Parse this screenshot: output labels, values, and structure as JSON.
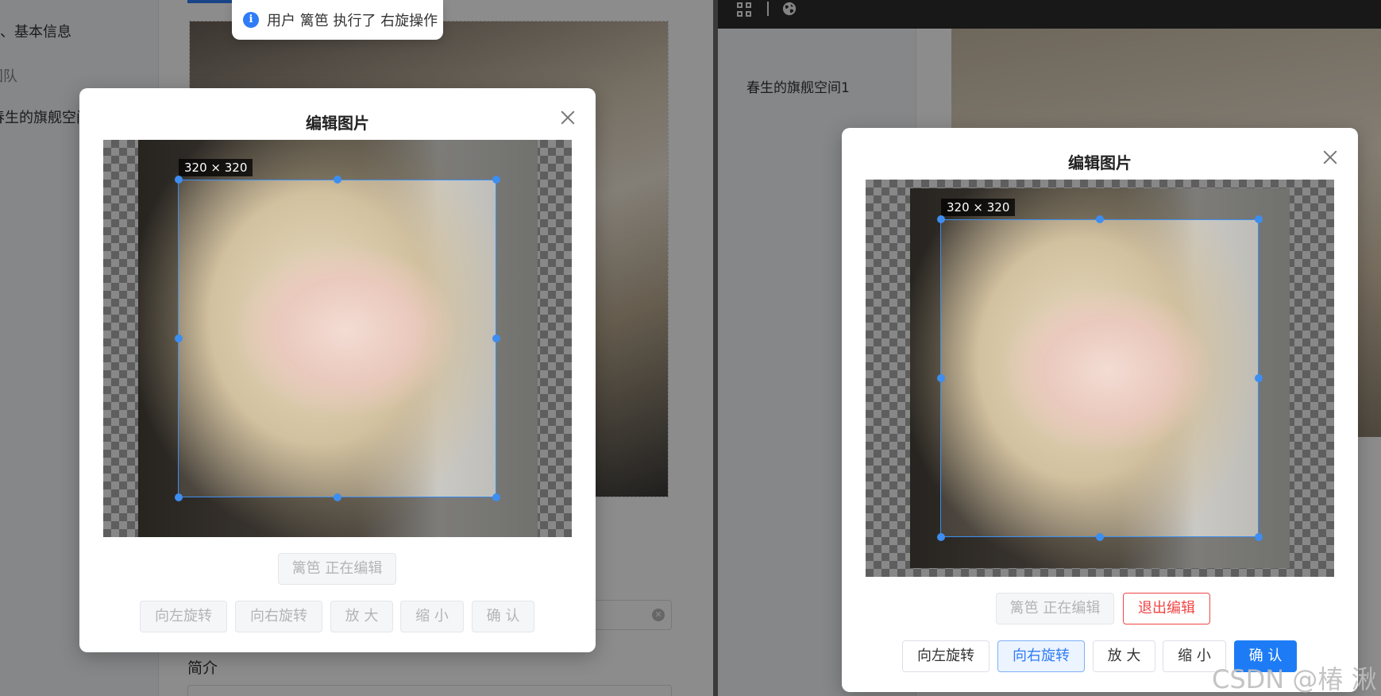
{
  "left": {
    "sidebar": {
      "items": [
        {
          "label": "、基本信息"
        },
        {
          "label": "团队"
        },
        {
          "label": "春生的旗舰空间"
        }
      ]
    },
    "intro_label": "简介",
    "toast": {
      "icon": "info-icon",
      "text": "用户 篱笆 执行了 右旋操作"
    },
    "modal": {
      "title": "编辑图片",
      "crop_size": "320 × 320",
      "editing_status": "篱笆 正在编辑",
      "buttons": {
        "rotate_left": "向左旋转",
        "rotate_right": "向右旋转",
        "zoom_in": "放 大",
        "zoom_out": "缩 小",
        "confirm": "确 认"
      }
    }
  },
  "right": {
    "topbar": {
      "icons": [
        "grid-icon",
        "globe-icon"
      ]
    },
    "sidebar": {
      "space_name": "春生的旗舰空间1"
    },
    "modal": {
      "title": "编辑图片",
      "crop_size": "320 × 320",
      "editing_status": "篱笆 正在编辑",
      "exit_edit": "退出编辑",
      "buttons": {
        "rotate_left": "向左旋转",
        "rotate_right": "向右旋转",
        "zoom_in": "放 大",
        "zoom_out": "缩 小",
        "confirm": "确 认"
      }
    }
  },
  "watermark": "CSDN @椿 湫",
  "colors": {
    "accent": "#1d7cf5",
    "crop_border": "#3d8ef0",
    "danger": "#f04646"
  }
}
